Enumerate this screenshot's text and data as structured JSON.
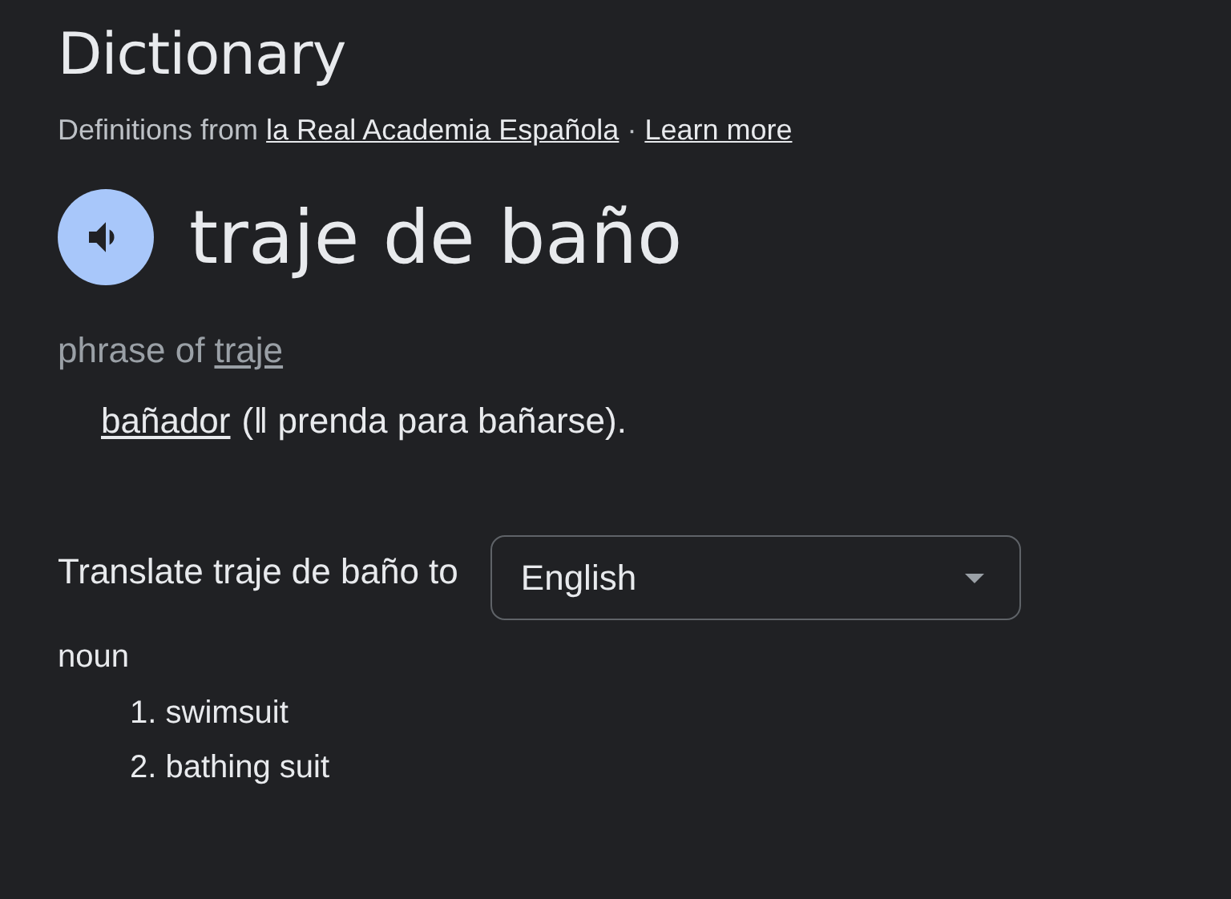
{
  "title": "Dictionary",
  "source": {
    "prefix": "Definitions from",
    "link": "la Real Academia Española",
    "separator": "·",
    "learn_more": "Learn more"
  },
  "headword": "traje de baño",
  "phrase": {
    "prefix": "phrase of",
    "link": "traje"
  },
  "definition": {
    "link": "bañador",
    "text": "(‖ prenda para bañarse)."
  },
  "translate": {
    "label": "Translate traje de baño to",
    "language": "English"
  },
  "part_of_speech": "noun",
  "translations": [
    {
      "number": "1.",
      "text": "swimsuit"
    },
    {
      "number": "2.",
      "text": "bathing suit"
    }
  ]
}
